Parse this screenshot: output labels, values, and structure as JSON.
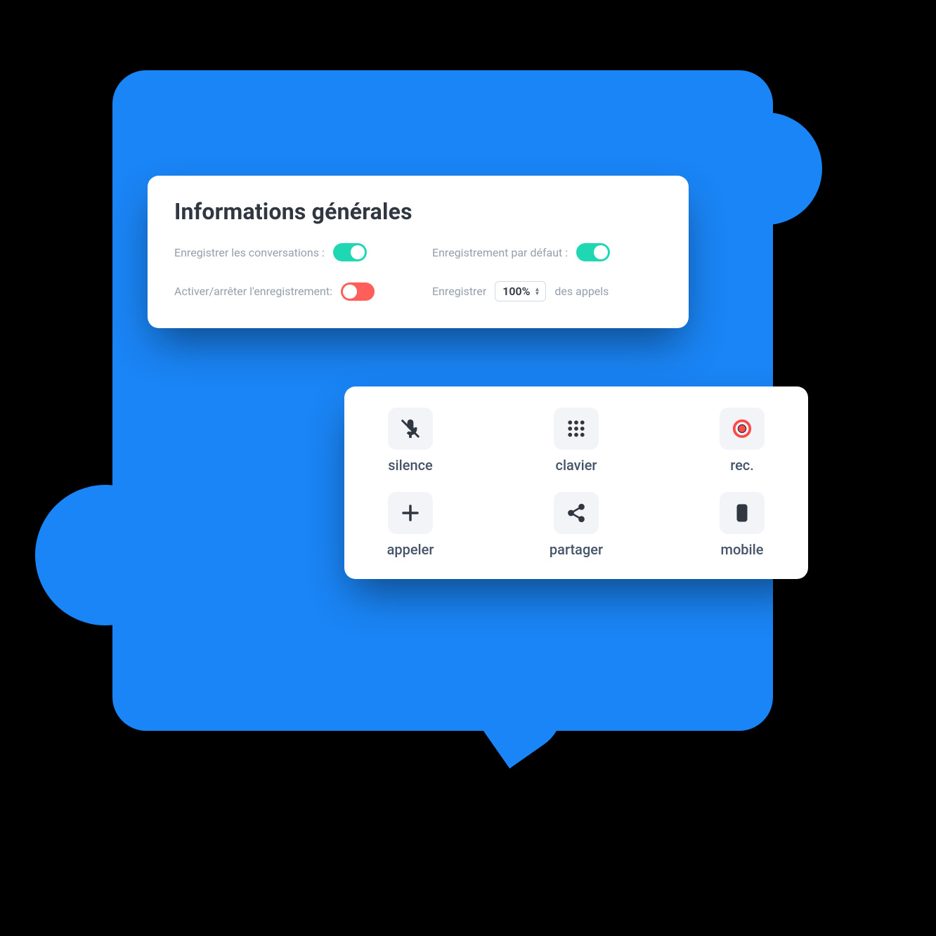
{
  "settings": {
    "title": "Informations générales",
    "record_conv_label": "Enregistrer les conversations :",
    "record_conv_on": true,
    "default_record_label": "Enregistrement par défaut :",
    "default_record_on": true,
    "toggle_record_label": "Activer/arrêter l'enregistrement:",
    "toggle_record_on": false,
    "pct_prefix": "Enregistrer",
    "pct_value": "100%",
    "pct_suffix": "des appels"
  },
  "actions": {
    "silence": "silence",
    "clavier": "clavier",
    "rec": "rec.",
    "appeler": "appeler",
    "partager": "partager",
    "mobile": "mobile"
  }
}
